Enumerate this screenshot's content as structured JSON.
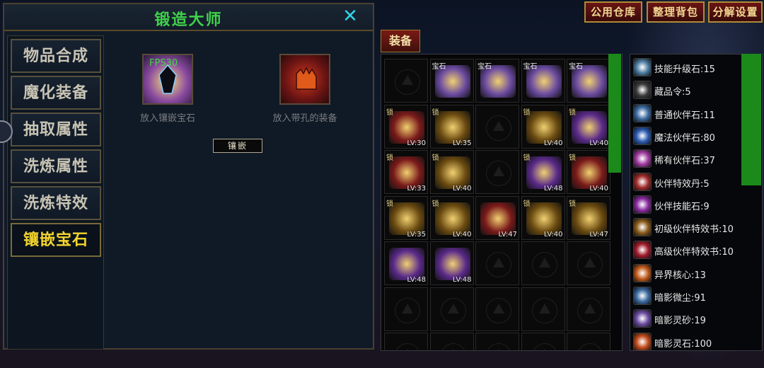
{
  "forge": {
    "title": "锻造大师",
    "fps": "FPS30",
    "tabs": [
      "物品合成",
      "魔化装备",
      "抽取属性",
      "洗炼属性",
      "洗炼特效",
      "镶嵌宝石"
    ],
    "active_tab": 5,
    "slot_gem_label": "放入镶嵌宝石",
    "slot_equip_label": "放入带孔的装备",
    "embed_button": "镶嵌"
  },
  "top_buttons": [
    "公用仓库",
    "整理背包",
    "分解设置"
  ],
  "equip_tab": "装备",
  "bag": {
    "cells": [
      {
        "empty": true
      },
      {
        "badge": "宝石",
        "icon": "gem-icon",
        "color": "#6a4aa0"
      },
      {
        "badge": "宝石",
        "icon": "gem-icon",
        "color": "#6a4aa0"
      },
      {
        "badge": "宝石",
        "icon": "gem-icon",
        "color": "#6a4aa0"
      },
      {
        "badge": "宝石",
        "icon": "gem-icon",
        "color": "#6a4aa0"
      },
      {
        "lock": "锁",
        "lv": "LV:30",
        "icon": "sword-icon",
        "color": "#7a1a1a"
      },
      {
        "lock": "锁",
        "lv": "LV:35",
        "icon": "sword-icon",
        "color": "#6a4a10"
      },
      {
        "empty": true
      },
      {
        "lock": "锁",
        "lv": "LV:40",
        "icon": "gauntlet-icon",
        "color": "#6a4a10"
      },
      {
        "lock": "锁",
        "lv": "LV:40",
        "icon": "ring-icon",
        "color": "#5a2a8a"
      },
      {
        "lock": "锁",
        "lv": "LV:33",
        "icon": "helmet-icon",
        "color": "#7a1a1a"
      },
      {
        "lock": "锁",
        "lv": "LV:40",
        "icon": "armor-icon",
        "color": "#6a4a10"
      },
      {
        "empty": true
      },
      {
        "lock": "锁",
        "lv": "LV:48",
        "icon": "armor-icon",
        "color": "#5a2a8a"
      },
      {
        "lock": "锁",
        "lv": "LV:40",
        "icon": "helmet-icon",
        "color": "#7a1a1a"
      },
      {
        "lock": "锁",
        "lv": "LV:35",
        "icon": "shield-icon",
        "color": "#6a4a10"
      },
      {
        "lock": "锁",
        "lv": "LV:40",
        "icon": "shield-icon",
        "color": "#6a4a10"
      },
      {
        "lv": "LV:47",
        "icon": "legs-icon",
        "color": "#7a1a1a"
      },
      {
        "lock": "锁",
        "lv": "LV:40",
        "icon": "shoulder-icon",
        "color": "#6a4a10"
      },
      {
        "lock": "锁",
        "lv": "LV:47",
        "icon": "shoulder-icon",
        "color": "#6a4a10"
      },
      {
        "lv": "LV:48",
        "icon": "mace-icon",
        "color": "#5a2a8a"
      },
      {
        "lv": "LV:48",
        "icon": "armor-icon",
        "color": "#5a2a8a"
      },
      {
        "empty": true
      },
      {
        "empty": true
      },
      {
        "empty": true
      },
      {
        "empty": true
      },
      {
        "empty": true
      },
      {
        "empty": true
      },
      {
        "empty": true
      },
      {
        "empty": true
      },
      {
        "empty": true
      },
      {
        "empty": true
      },
      {
        "empty": true
      },
      {
        "empty": true
      },
      {
        "empty": true
      }
    ]
  },
  "materials": [
    {
      "label": "技能升级石:15",
      "icon": "skill-stone-icon",
      "color": "#4a7aa0"
    },
    {
      "label": "藏品令:5",
      "icon": "token-icon",
      "color": "#3a3a3a"
    },
    {
      "label": "普通伙伴石:11",
      "icon": "crystal-icon",
      "color": "#3a6aa0"
    },
    {
      "label": "魔法伙伴石:80",
      "icon": "crystal-icon",
      "color": "#2a5ab0"
    },
    {
      "label": "稀有伙伴石:37",
      "icon": "crystal-icon",
      "color": "#a03aa0"
    },
    {
      "label": "伙伴特效丹:5",
      "icon": "pill-icon",
      "color": "#a02a2a"
    },
    {
      "label": "伙伴技能石:9",
      "icon": "stone-icon",
      "color": "#8a2aa0"
    },
    {
      "label": "初级伙伴特效书:10",
      "icon": "book-icon",
      "color": "#8a5a1a"
    },
    {
      "label": "高级伙伴特效书:10",
      "icon": "book-icon",
      "color": "#a01a2a"
    },
    {
      "label": "异界核心:13",
      "icon": "core-icon",
      "color": "#c05a1a"
    },
    {
      "label": "暗影微尘:91",
      "icon": "dust-icon",
      "color": "#3a6aa0"
    },
    {
      "label": "暗影灵砂:19",
      "icon": "sand-icon",
      "color": "#6a4aa0"
    },
    {
      "label": "暗影灵石:100",
      "icon": "shadow-stone-icon",
      "color": "#c04a1a"
    }
  ]
}
